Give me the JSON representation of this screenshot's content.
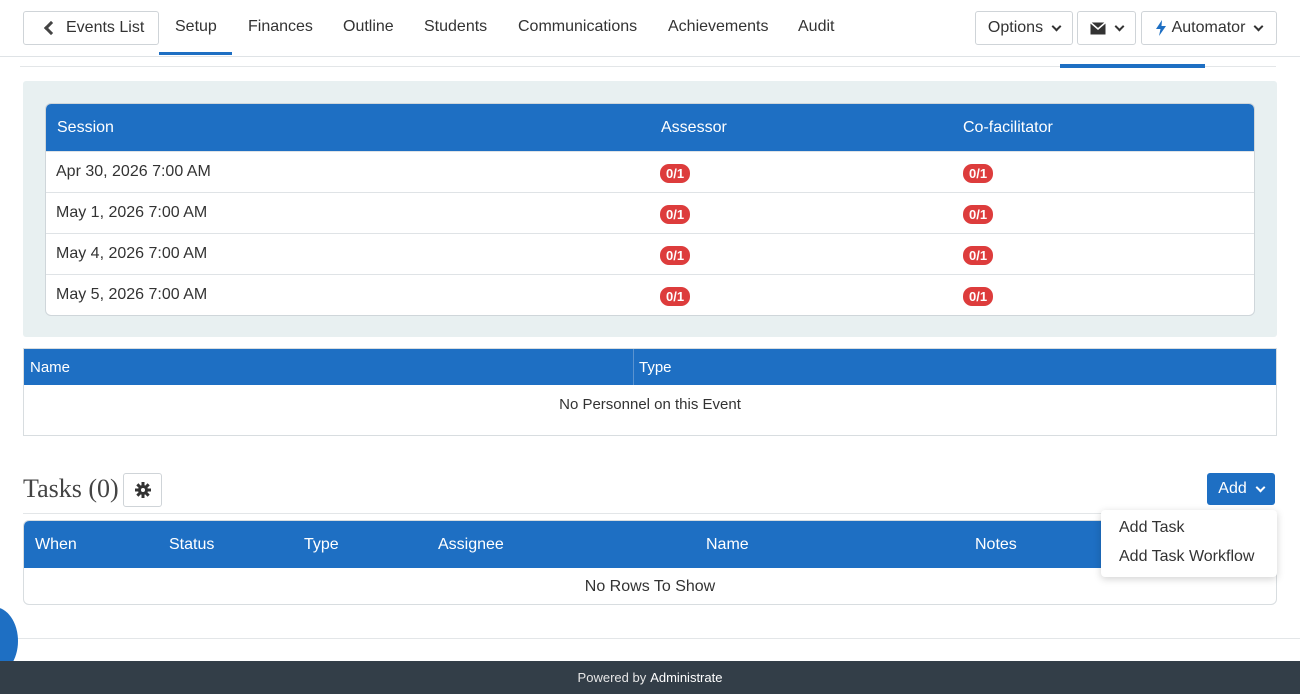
{
  "nav": {
    "back_label": "Events List",
    "tabs": [
      "Setup",
      "Finances",
      "Outline",
      "Students",
      "Communications",
      "Achievements",
      "Audit"
    ],
    "options_label": "Options",
    "automator_label": "Automator"
  },
  "sessions": {
    "headers": [
      "Session",
      "Assessor",
      "Co-facilitator"
    ],
    "rows": [
      {
        "date": "Apr 30, 2026 7:00 AM",
        "assessor": "0/1",
        "cofacilitator": "0/1"
      },
      {
        "date": "May 1, 2026 7:00 AM",
        "assessor": "0/1",
        "cofacilitator": "0/1"
      },
      {
        "date": "May 4, 2026 7:00 AM",
        "assessor": "0/1",
        "cofacilitator": "0/1"
      },
      {
        "date": "May 5, 2026 7:00 AM",
        "assessor": "0/1",
        "cofacilitator": "0/1"
      }
    ]
  },
  "personnel": {
    "headers": [
      "Name",
      "Type"
    ],
    "empty_message": "No Personnel on this Event"
  },
  "tasks": {
    "title": "Tasks (0)",
    "add_label": "Add",
    "headers": [
      "When",
      "Status",
      "Type",
      "Assignee",
      "Name",
      "Notes"
    ],
    "empty_message": "No Rows To Show",
    "dropdown": [
      "Add Task",
      "Add Task Workflow"
    ]
  },
  "footer": {
    "prefix": "Powered by",
    "brand": "Administrate"
  },
  "colors": {
    "primary": "#1e6fc3",
    "badge": "#dd3c3c",
    "footer": "#333e48"
  }
}
